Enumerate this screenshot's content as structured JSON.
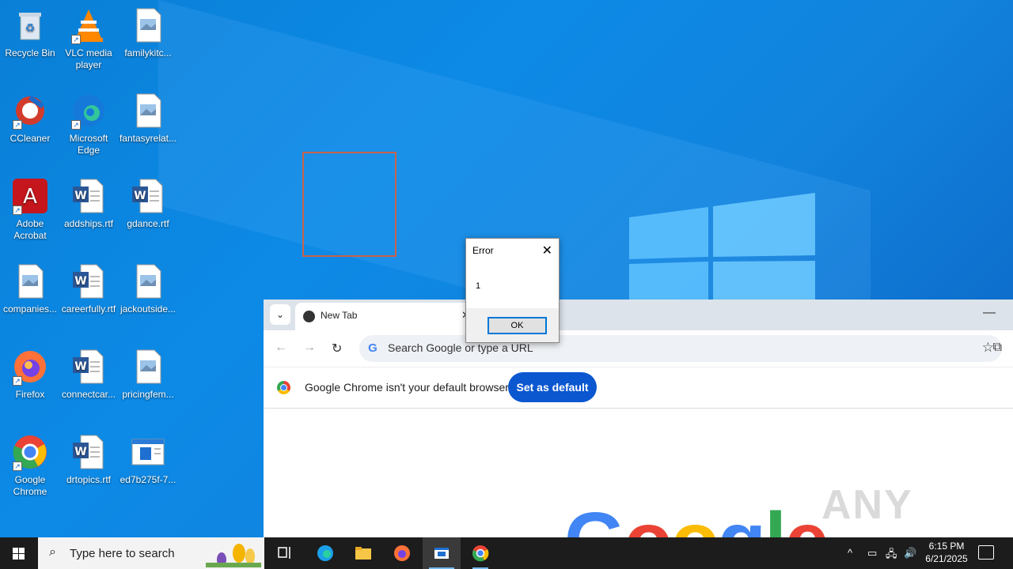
{
  "desktop": {
    "icons": [
      {
        "label": "Recycle Bin",
        "icon": "recycle-bin-icon"
      },
      {
        "label": "VLC media player",
        "icon": "vlc-icon"
      },
      {
        "label": "familykitc...",
        "icon": "image-file-icon"
      },
      {
        "label": "CCleaner",
        "icon": "ccleaner-icon"
      },
      {
        "label": "Microsoft Edge",
        "icon": "edge-icon"
      },
      {
        "label": "fantasyrelat...",
        "icon": "image-file-icon"
      },
      {
        "label": "Adobe Acrobat",
        "icon": "acrobat-icon"
      },
      {
        "label": "addships.rtf",
        "icon": "word-doc-icon"
      },
      {
        "label": "gdance.rtf",
        "icon": "word-doc-icon"
      },
      {
        "label": "companies...",
        "icon": "image-file-icon"
      },
      {
        "label": "careerfully.rtf",
        "icon": "word-doc-icon"
      },
      {
        "label": "jackoutside...",
        "icon": "image-file-icon"
      },
      {
        "label": "Firefox",
        "icon": "firefox-icon"
      },
      {
        "label": "connectcar...",
        "icon": "word-doc-icon"
      },
      {
        "label": "pricingfem...",
        "icon": "image-file-icon"
      },
      {
        "label": "Google Chrome",
        "icon": "chrome-icon"
      },
      {
        "label": "drtopics.rtf",
        "icon": "word-doc-icon"
      },
      {
        "label": "ed7b275f-7...",
        "icon": "exe-file-icon"
      }
    ]
  },
  "chrome": {
    "tab_title": "New Tab",
    "omnibox_placeholder": "Search Google or type a URL",
    "infobar_message": "Google Chrome isn't your default browser",
    "set_default_label": "Set as default",
    "logo_letters": [
      "G",
      "o",
      "o",
      "g",
      "l",
      "e"
    ],
    "logo_colors": [
      "#4285f4",
      "#ea4335",
      "#fbbc05",
      "#4285f4",
      "#34a853",
      "#ea4335"
    ]
  },
  "dialog": {
    "title": "Error",
    "message": "1",
    "ok_label": "OK"
  },
  "watermark": "ANY RUN",
  "taskbar": {
    "search_placeholder": "Type here to search",
    "time": "6:15 PM",
    "date": "6/21/2025"
  },
  "colors": {
    "accent": "#0b57d0",
    "taskbar": "#1c1c1c"
  }
}
